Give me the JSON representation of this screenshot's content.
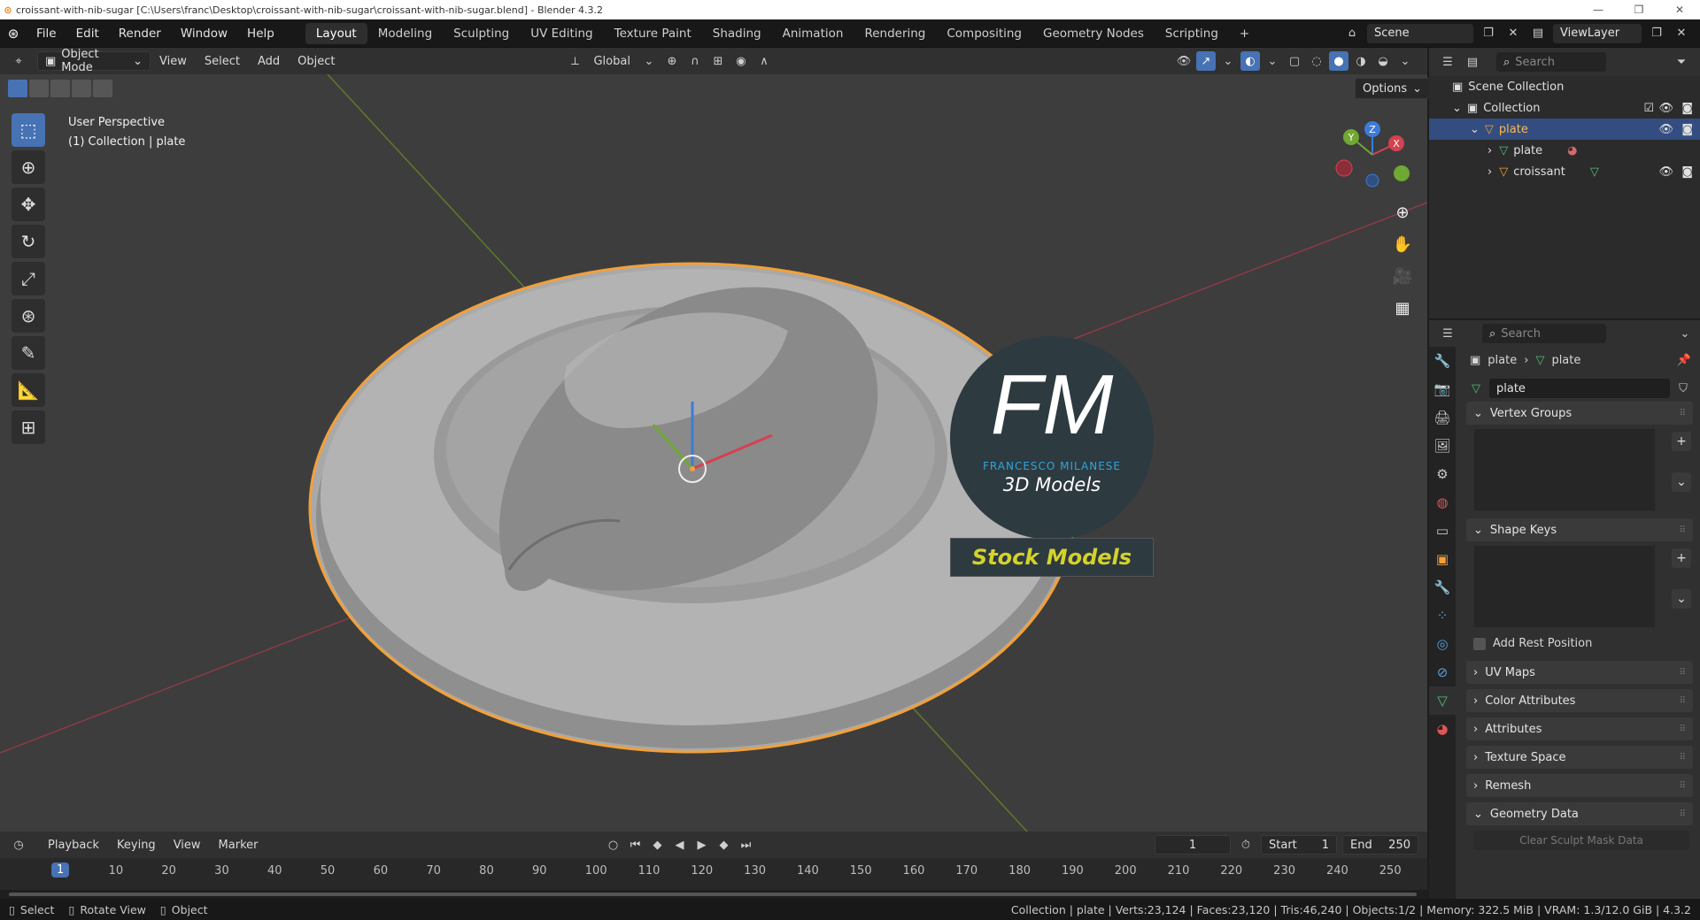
{
  "window": {
    "title": "croissant-with-nib-sugar [C:\\Users\\franc\\Desktop\\croissant-with-nib-sugar\\croissant-with-nib-sugar.blend] - Blender 4.3.2",
    "min": "—",
    "max": "❐",
    "close": "✕"
  },
  "menu": [
    "File",
    "Edit",
    "Render",
    "Window",
    "Help"
  ],
  "workspaces": [
    "Layout",
    "Modeling",
    "Sculpting",
    "UV Editing",
    "Texture Paint",
    "Shading",
    "Animation",
    "Rendering",
    "Compositing",
    "Geometry Nodes",
    "Scripting"
  ],
  "active_workspace": "Layout",
  "scene": "Scene",
  "viewlayer": "ViewLayer",
  "viewport": {
    "mode": "Object Mode",
    "menus": [
      "View",
      "Select",
      "Add",
      "Object"
    ],
    "orientation": "Global",
    "options": "Options",
    "perspective": "User Perspective",
    "collection_info": "(1) Collection | plate"
  },
  "gizmo": {
    "x": "X",
    "y": "Y",
    "z": "Z"
  },
  "watermark": {
    "letters": "FM",
    "name": "FRANCESCO MILANESE",
    "sub": "3D Models",
    "badge": "Stock Models"
  },
  "outliner": {
    "search": "Search",
    "scene_collection": "Scene Collection",
    "collection": "Collection",
    "items": [
      {
        "name": "plate",
        "level": 2,
        "selected": true
      },
      {
        "name": "plate",
        "level": 3
      },
      {
        "name": "croissant",
        "level": 3
      }
    ]
  },
  "properties": {
    "search": "Search",
    "breadcrumb_obj": "plate",
    "breadcrumb_data": "plate",
    "mesh_name": "plate",
    "panels": {
      "vertex_groups": "Vertex Groups",
      "shape_keys": "Shape Keys",
      "add_rest": "Add Rest Position",
      "uv_maps": "UV Maps",
      "color_attributes": "Color Attributes",
      "attributes": "Attributes",
      "texture_space": "Texture Space",
      "remesh": "Remesh",
      "geometry_data": "Geometry Data",
      "clear_sculpt": "Clear Sculpt Mask Data"
    }
  },
  "timeline": {
    "menus": [
      "Playback",
      "Keying",
      "View",
      "Marker"
    ],
    "current_frame": "1",
    "start_label": "Start",
    "start": "1",
    "end_label": "End",
    "end": "250",
    "ruler": [
      "1",
      "10",
      "20",
      "30",
      "40",
      "50",
      "60",
      "70",
      "80",
      "90",
      "100",
      "110",
      "120",
      "130",
      "140",
      "150",
      "160",
      "170",
      "180",
      "190",
      "200",
      "210",
      "220",
      "230",
      "240",
      "250"
    ]
  },
  "statusbar": {
    "hints": [
      "Select",
      "Rotate View",
      "Object"
    ],
    "stats": "Collection | plate | Verts:23,124 | Faces:23,120 | Tris:46,240 | Objects:1/2 | Memory: 322.5 MiB | VRAM: 1.3/12.0 GiB | 4.3.2"
  },
  "colors": {
    "accent": "#4772b3",
    "selection_orange": "#f2a03a",
    "outliner_selected": "#334d80"
  }
}
